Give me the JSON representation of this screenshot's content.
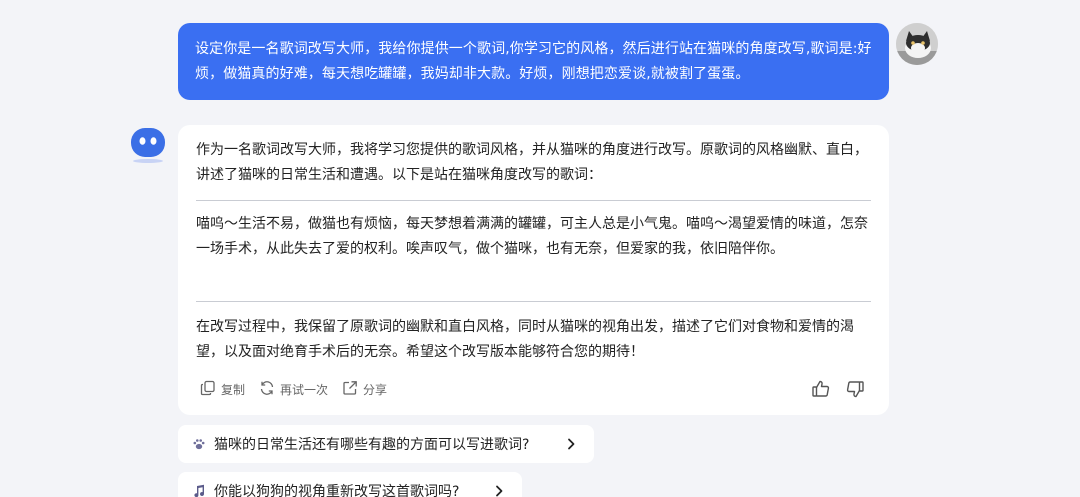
{
  "user_message": {
    "text": "设定你是一名歌词改写大师，我给你提供一个歌词,你学习它的风格，然后进行站在猫咪的角度改写,歌词是:好烦，做猫真的好难，每天想吃罐罐，我妈却非大款。好烦，刚想把恋爱谈,就被割了蛋蛋。"
  },
  "bot_message": {
    "intro": "作为一名歌词改写大师，我将学习您提供的歌词风格，并从猫咪的角度进行改写。原歌词的风格幽默、直白，讲述了猫咪的日常生活和遭遇。以下是站在猫咪角度改写的歌词：",
    "lyrics": "喵呜～生活不易，做猫也有烦恼，每天梦想着满满的罐罐，可主人总是小气鬼。喵呜～渴望爱情的味道，怎奈一场手术，从此失去了爱的权利。唉声叹气，做个猫咪，也有无奈，但爱家的我，依旧陪伴你。",
    "outro": "在改写过程中，我保留了原歌词的幽默和直白风格，同时从猫咪的视角出发，描述了它们对食物和爱情的渴望，以及面对绝育手术后的无奈。希望这个改写版本能够符合您的期待！"
  },
  "actions": {
    "copy_label": "复制",
    "retry_label": "再试一次",
    "share_label": "分享"
  },
  "suggestions": [
    {
      "text": "猫咪的日常生活还有哪些有趣的方面可以写进歌词?",
      "icon": "paw-icon"
    },
    {
      "text": "你能以狗狗的视角重新改写这首歌词吗?",
      "icon": "music-note-icon"
    }
  ],
  "colors": {
    "user_bubble": "#3a6ff2",
    "bot_avatar": "#3b6fe6",
    "background": "#f3f4f8"
  }
}
